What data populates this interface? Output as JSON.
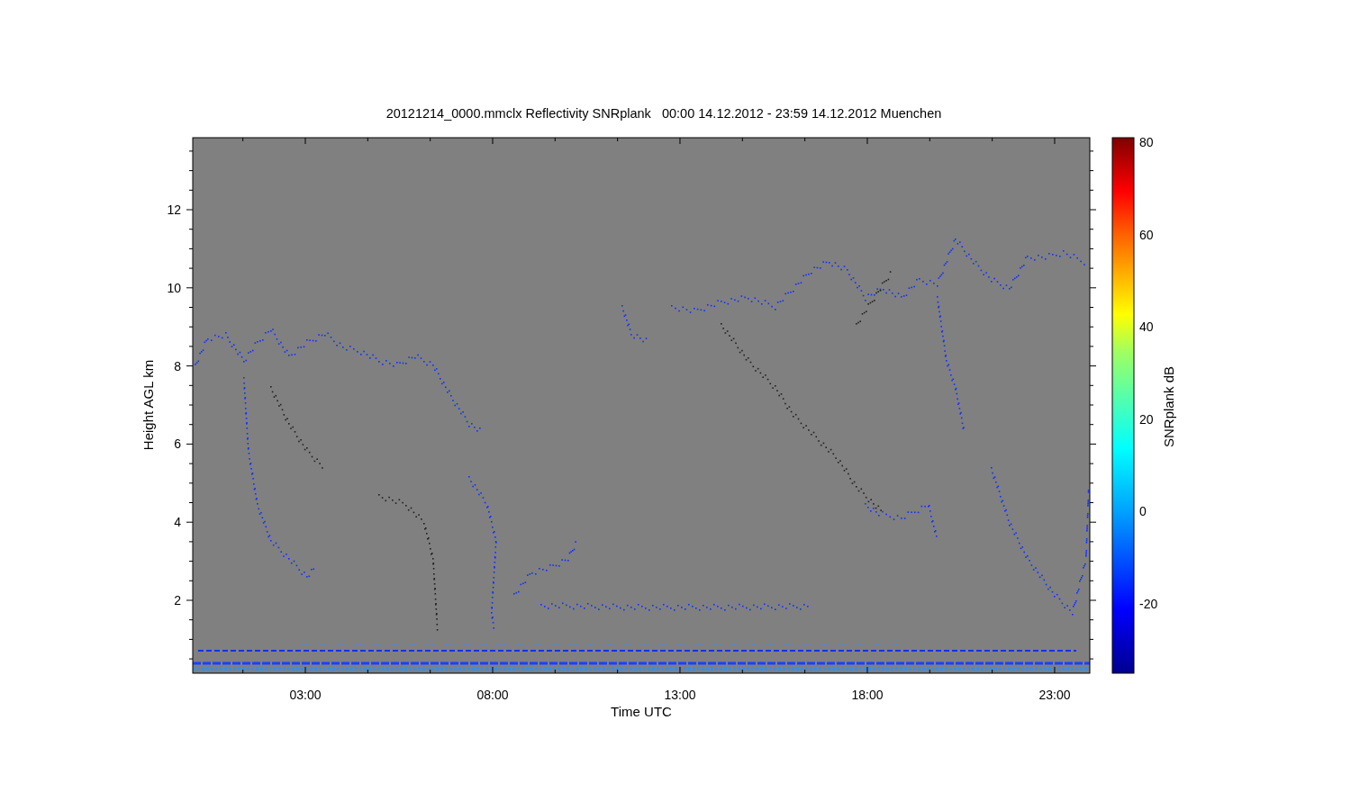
{
  "title": "20121214_0000.mmclx Reflectivity SNRplank   00:00 14.12.2012 - 23:59 14.12.2012 Muenchen",
  "y_axis": {
    "label": "Height AGL km",
    "ticks": [
      "12",
      "10",
      "8",
      "6",
      "4",
      "2"
    ]
  },
  "x_axis": {
    "label": "Time UTC",
    "ticks": [
      "03:00",
      "08:00",
      "13:00",
      "18:00",
      "23:00"
    ]
  },
  "colorbar": {
    "label": "SNRplank dB",
    "ticks": [
      "80",
      "60",
      "40",
      "20",
      "0",
      "-20"
    ]
  }
}
